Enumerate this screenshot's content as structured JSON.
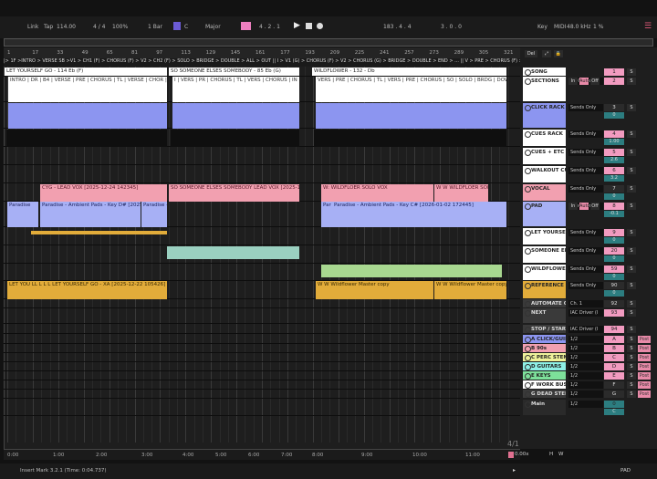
{
  "toolbar": {
    "link": "Link",
    "tap": "Tap",
    "tempo": "114.00",
    "signature": "4 / 4",
    "zoom": "100%",
    "quantize": "1 Bar",
    "key": "C",
    "scale": "Major",
    "position": "4 . 2 . 1",
    "loop_start": "183 . 4 . 4",
    "loop_length": "3 . 0 . 0",
    "key_btn": "Key",
    "midi": "MIDI",
    "sample_rate": "48.0 kHz",
    "cpu": "1 %"
  },
  "ruler": {
    "bars": [
      "1",
      "17",
      "33",
      "49",
      "65",
      "81",
      "97",
      "113",
      "129",
      "145",
      "161",
      "177",
      "193",
      "209",
      "225",
      "241",
      "257",
      "273",
      "289",
      "305",
      "321"
    ]
  },
  "locators": "|> 1F >INTRO > VERSE SB >V1 > CH1 (F) > CHORUS (F) > V2 > CH2 (F) > SOLO > BRIDGE > DOUBLE > ALL > OUT || I > V1 (G) > CHORUS (F) > V2 > CHORUS (G) > BRIDGE > DOUBLE > END > ... || V > PRE > CHORUS (F) > V1 > PRE > CHORUS > SOLO > BRDG > DOUB > CHOR > OUT > END",
  "clips": {
    "song": [
      "LET YOURSELF GO - 114  Eb (F)",
      "SO SOMEONE ELSES SOMEBODY - 85 Eb (G)",
      "WILDFLOWER - 132 - Db"
    ],
    "sections": [
      "INTRO | DR | B4 | VERSE | PRE | CHORUS | TL | VERSE | CHOR | SOLO | BRIDGE | DOW | ALL | R | OUT",
      "I | VERS | PR | CHORUS | TL | VERS | CHORUS | IN | BRIDG | DOUB | UP | DE | OUT | END",
      "VERS | PRE | CHORUS | TL | VERS | PRE | CHORUS | SO | SOLO | BRDG | DOWN | CHOR | OUT"
    ],
    "vocal": [
      "CYG - LEAD VOX [2025-12-24 142345]",
      "SO SOMEONE ELSES SOMEBODY LEAD VOX [2025-12-20 13",
      "W: WILDFLOER SOLO VOX",
      "W W WILDFLOER SOLO V"
    ],
    "pad": [
      "Paradise",
      "Paradise - Ambient Pads - Key D# [2025-12-15 1",
      "Paradise - A",
      "Par P",
      "Paradise - Ambient Pads - Key C# [2026-01-02 172445]"
    ],
    "reference": [
      "LET YOU LL L L L LET YOURSELF GO - XA [2025-12-22 105426]",
      "W W Wildflower Master copy",
      "W W Wildflower Master copy"
    ]
  },
  "time_ruler": [
    "0:00",
    "1:00",
    "2:00",
    "3:00",
    "4:00",
    "5:00",
    "6:00",
    "7:00",
    "8:00",
    "9:00",
    "10:00",
    "11:00"
  ],
  "loop_indicator": "4/1",
  "panel": {
    "del": "Del",
    "zoom_value": "0.00x",
    "h": "H",
    "w": "W",
    "tracks": [
      {
        "name": "SONG",
        "color": "#ffffff",
        "vol": "1",
        "s": "S",
        "io": "",
        "volcolor": "#f29bc0"
      },
      {
        "name": "SECTIONS",
        "color": "#ffffff",
        "vol": "2",
        "s": "S",
        "io": "No Output",
        "volcolor": "#f29bc0",
        "monitor": [
          "In",
          "Auto",
          "Off"
        ]
      },
      {
        "name": "CLICK RACK",
        "color": "#8c95f0",
        "vol": "3",
        "s": "S",
        "io": "Sends Only",
        "volcolor": "#2b2b2b",
        "pan": "0"
      },
      {
        "name": "CUES RACK",
        "color": "#ffffff",
        "vol": "4",
        "s": "S",
        "io": "Sends Only",
        "volcolor": "#f29bc0",
        "pan": "1.00"
      },
      {
        "name": "CUES + ETC",
        "color": "#ffffff",
        "vol": "5",
        "s": "S",
        "io": "Sends Only",
        "volcolor": "#f29bc0",
        "pan": "2.6"
      },
      {
        "name": "WALKOUT CUE",
        "color": "#ffffff",
        "vol": "6",
        "s": "S",
        "io": "Sends Only",
        "volcolor": "#f29bc0",
        "pan": "3.2"
      },
      {
        "name": "VOCAL",
        "color": "#f2a0b0",
        "vol": "7",
        "s": "S",
        "io": "Sends Only",
        "volcolor": "#2b2b2b",
        "pan": "0"
      },
      {
        "name": "PAD",
        "color": "#a7b0f5",
        "vol": "8",
        "s": "S",
        "io": "Sends Only",
        "volcolor": "#f29bc0",
        "pan": "-0.1",
        "monitor": [
          "In",
          "Auto",
          "Off"
        ]
      },
      {
        "name": "LET YOURSELF G",
        "color": "#ffffff",
        "vol": "9",
        "s": "S",
        "io": "Sends Only",
        "volcolor": "#f29bc0",
        "pan": "0"
      },
      {
        "name": "SOMEONE ELSES",
        "color": "#ffffff",
        "vol": "20",
        "s": "S",
        "io": "Sends Only",
        "volcolor": "#f29bc0",
        "pan": "0"
      },
      {
        "name": "WILDFLOWER",
        "color": "#ffffff",
        "vol": "59",
        "s": "S",
        "io": "Sends Only",
        "volcolor": "#f29bc0",
        "pan": "0"
      },
      {
        "name": "REFERENCE",
        "color": "#e2ac3a",
        "vol": "90",
        "s": "S",
        "io": "Sends Only",
        "volcolor": "#2b2b2b",
        "pan": "0"
      },
      {
        "name": "AUTOMATE ON",
        "color": "#3a3a3a",
        "vol": "92",
        "s": "S",
        "io": "Ch. 1",
        "volcolor": "#2b2b2b"
      },
      {
        "name": "NEXT",
        "color": "#3a3a3a",
        "vol": "93",
        "s": "S",
        "io": "IAC Driver (I",
        "volcolor": "#f29bc0"
      },
      {
        "name": "STOP / START",
        "color": "#3a3a3a",
        "vol": "94",
        "s": "S",
        "io": "IAC Driver (I",
        "volcolor": "#f29bc0"
      },
      {
        "name": "A CLICK/GUIDE",
        "color": "#8c95f0",
        "vol": "A",
        "s": "S",
        "io": "1/2",
        "volcolor": "#f29bc0",
        "post": "Post"
      },
      {
        "name": "B 90s",
        "color": "#f2a0b0",
        "vol": "B",
        "s": "S",
        "io": "1/2",
        "volcolor": "#f29bc0",
        "post": "Post"
      },
      {
        "name": "C PERC STEMS",
        "color": "#eef29a",
        "vol": "C",
        "s": "S",
        "io": "1/2",
        "volcolor": "#f29bc0",
        "post": "Post"
      },
      {
        "name": "D GUITARS",
        "color": "#8ef0e6",
        "vol": "D",
        "s": "S",
        "io": "1/2",
        "volcolor": "#f29bc0",
        "post": "Post"
      },
      {
        "name": "E KEYS",
        "color": "#7de09a",
        "vol": "E",
        "s": "S",
        "io": "1/2",
        "volcolor": "#f29bc0",
        "post": "Post"
      },
      {
        "name": "F WORK BUS",
        "color": "#ffffff",
        "vol": "F",
        "s": "S",
        "io": "1/2",
        "volcolor": "#2b2b2b",
        "post": "Post"
      },
      {
        "name": "G DEAD STEMS",
        "color": "#3a3a3a",
        "vol": "G",
        "s": "S",
        "io": "1/2",
        "volcolor": "#2b2b2b",
        "post": "Post"
      },
      {
        "name": "Main",
        "color": "#2a2a2a",
        "vol": "0",
        "s": "",
        "io": "1/2",
        "volcolor": "#2c7d80",
        "pan": "C"
      }
    ]
  },
  "status": {
    "text": "Insert Mark 3.2.1 (Time: 0:04.737)",
    "pad": "PAD"
  }
}
